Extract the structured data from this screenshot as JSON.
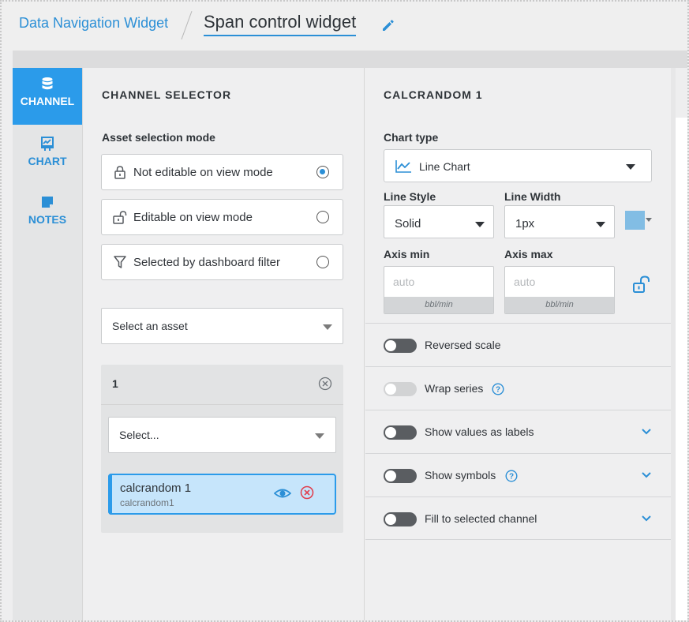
{
  "breadcrumb": {
    "parent": "Data Navigation Widget",
    "current": "Span control widget"
  },
  "rail": {
    "items": [
      {
        "label": "CHANNEL",
        "icon": "database-icon",
        "active": true
      },
      {
        "label": "CHART",
        "icon": "chart-icon",
        "active": false
      },
      {
        "label": "NOTES",
        "icon": "note-icon",
        "active": false
      }
    ]
  },
  "channel_selector": {
    "title": "CHANNEL SELECTOR",
    "asset_mode_label": "Asset selection mode",
    "modes": [
      {
        "label": "Not editable on view mode",
        "icon": "lock-closed-icon",
        "selected": true
      },
      {
        "label": "Editable on view mode",
        "icon": "lock-open-icon",
        "selected": false
      },
      {
        "label": "Selected by dashboard filter",
        "icon": "filter-icon",
        "selected": false
      }
    ],
    "asset_select": "Select an asset",
    "group": {
      "number": "1",
      "select_placeholder": "Select...",
      "channel": {
        "name": "calcrandom 1",
        "id": "calcrandom1"
      }
    }
  },
  "settings": {
    "title": "CALCRANDOM 1",
    "chart_type_label": "Chart type",
    "chart_type_value": "Line Chart",
    "line_style_label": "Line Style",
    "line_style_value": "Solid",
    "line_width_label": "Line Width",
    "line_width_value": "1px",
    "series_color": "#82bde4",
    "axis_min_label": "Axis min",
    "axis_max_label": "Axis max",
    "axis_min_placeholder": "auto",
    "axis_max_placeholder": "auto",
    "axis_unit": "bbl/min",
    "options": [
      {
        "label": "Reversed scale",
        "enabled": true,
        "help": false,
        "expandable": false
      },
      {
        "label": "Wrap series",
        "enabled": false,
        "help": true,
        "expandable": false
      },
      {
        "label": "Show values as labels",
        "enabled": true,
        "help": false,
        "expandable": true
      },
      {
        "label": "Show symbols",
        "enabled": true,
        "help": true,
        "expandable": true
      },
      {
        "label": "Fill to selected channel",
        "enabled": true,
        "help": false,
        "expandable": true
      }
    ]
  },
  "colors": {
    "accent": "#2b9bea",
    "link": "#2b8fd6",
    "danger": "#e0404f"
  }
}
